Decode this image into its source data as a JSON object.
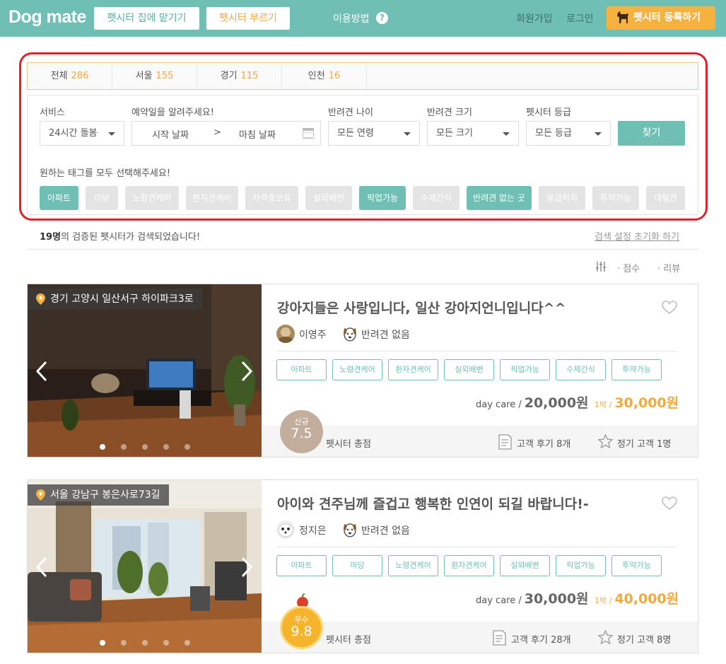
{
  "header": {
    "logo": "Dog mate",
    "btn_leave_at_sitter": "펫시터 집에 맡기기",
    "btn_call_sitter": "펫시터 부르기",
    "howto": "이용방법",
    "howto_icon": "?",
    "signup": "회원가입",
    "login": "로그인",
    "register_sitter": "펫시터 등록하기",
    "colors": {
      "brand": "#6fbfb5",
      "accent": "#f7b13f"
    }
  },
  "regions": [
    {
      "name": "전체",
      "count": "286"
    },
    {
      "name": "서울",
      "count": "155"
    },
    {
      "name": "경기",
      "count": "115"
    },
    {
      "name": "인천",
      "count": "16"
    }
  ],
  "filters": {
    "service_label": "서비스",
    "service_value": "24시간 돌봄",
    "date_label": "예약일을 알려주세요!",
    "start_date": "시작 날짜",
    "date_sep": ">",
    "end_date": "마침 날짜",
    "age_label": "반려견 나이",
    "age_value": "모든 연령",
    "size_label": "반려견 크기",
    "size_value": "모든 크기",
    "grade_label": "펫시터 등급",
    "grade_value": "모든 등급",
    "find_button": "찾기",
    "tag_hint": "원하는 태그를 모두 선택해주세요!",
    "tags": [
      {
        "label": "아파트",
        "selected": true
      },
      {
        "label": "마당",
        "selected": false
      },
      {
        "label": "노령견케어",
        "selected": false
      },
      {
        "label": "환자견케어",
        "selected": false
      },
      {
        "label": "자격증보유",
        "selected": false
      },
      {
        "label": "실외배변",
        "selected": false
      },
      {
        "label": "픽업가능",
        "selected": true
      },
      {
        "label": "수제간식",
        "selected": false
      },
      {
        "label": "반려견 없는 곳",
        "selected": true
      },
      {
        "label": "응급처치",
        "selected": false
      },
      {
        "label": "투약가능",
        "selected": false
      },
      {
        "label": "대형견",
        "selected": false
      }
    ]
  },
  "results": {
    "count_num": "19명",
    "count_text": "의 검증된 펫시터가 검색되었습니다!",
    "reset": "검색 설정 초기화 하기",
    "sort_score": "· 점수",
    "sort_review": "· 리뷰"
  },
  "cards": [
    {
      "location": "경기 고양시 일산서구 하이파크3로",
      "title": "강아지들은 사랑입니다, 일산 강아지언니입니다^^",
      "sitter_name": "이영주",
      "pet_status": "반려견 없음",
      "tags": [
        "아파트",
        "노령견케어",
        "환자견케어",
        "실외배변",
        "픽업가능",
        "수제간식",
        "투약가능"
      ],
      "daycare_label": "day care /",
      "daycare_price": "20,000원",
      "night_label": "1박 /",
      "night_price": "30,000원",
      "badge_label": "신규",
      "score": "7.5",
      "score_label": "펫시터 총점",
      "reviews": "고객 후기 8개",
      "regulars": "정기 고객 1명",
      "photo_index": 1,
      "photo_total": 5
    },
    {
      "location": "서울 강남구 봉은사로73길",
      "title": "아이와 견주님께 즐겁고 행복한 인연이 되길 바랍니다!-",
      "sitter_name": "정지은",
      "pet_status": "반려견 없음",
      "tags": [
        "아파트",
        "마당",
        "노령견케어",
        "환자견케어",
        "실외배변",
        "픽업가능",
        "투약가능"
      ],
      "daycare_label": "day care /",
      "daycare_price": "30,000원",
      "night_label": "1박 /",
      "night_price": "40,000원",
      "badge_label": "우수",
      "score": "9.8",
      "score_label": "펫시터 총점",
      "reviews": "고객 후기 28개",
      "regulars": "정기 고객 8명",
      "photo_index": 1,
      "photo_total": 5
    }
  ]
}
